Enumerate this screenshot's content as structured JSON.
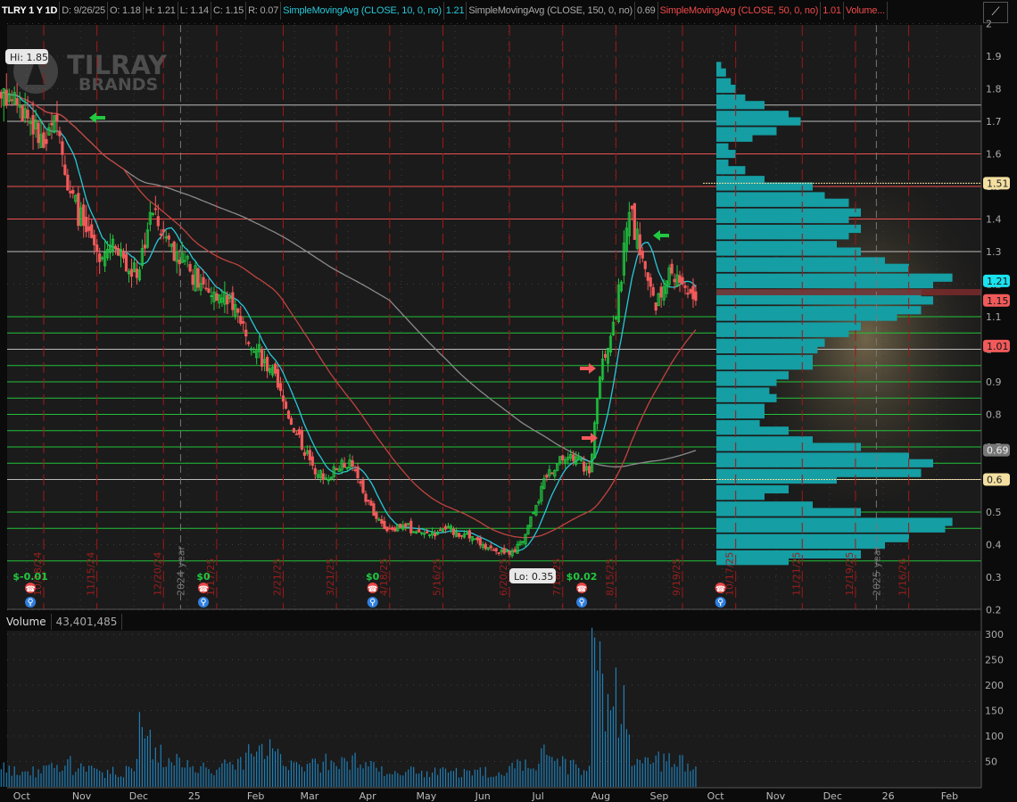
{
  "header": {
    "symbol": "TLRY 1 Y 1D",
    "date": "D: 9/26/25",
    "open": "O: 1.18",
    "high": "H: 1.21",
    "low": "L: 1.14",
    "close": "C: 1.15",
    "range": "R: 0.07",
    "sma10_label": "SimpleMovingAvg (CLOSE, 10, 0, no)",
    "sma10_value": "1.21",
    "sma150_label": "SimpleMovingAvg (CLOSE, 150, 0, no)",
    "sma150_value": "0.69",
    "sma50_label": "SimpleMovingAvg (CLOSE, 50, 0, no)",
    "sma50_value": "1.01",
    "volume_label": "Volume...",
    "studies_icon": "studies-icon"
  },
  "volume_header": {
    "label": "Volume",
    "value": "43,401,485"
  },
  "annotations": {
    "hi": "Hi: 1.85",
    "lo": "Lo: 0.35",
    "logo_line1": "TILRAY",
    "logo_line2": "BRANDS"
  },
  "colors": {
    "up": "#21c840",
    "down": "#f25a5a",
    "sma10": "#27c8d8",
    "sma50": "#c0433f",
    "sma150": "#8a8a8a",
    "profile": "#159ea3",
    "volume": "#1f7fb8"
  },
  "chart_data": {
    "type": "candlestick",
    "title": "TLRY 1 Y 1D",
    "start_date": "2024-09-27",
    "step_days": 7,
    "weekly_close": [
      1.8,
      1.75,
      1.7,
      1.62,
      1.7,
      1.48,
      1.38,
      1.3,
      1.32,
      1.28,
      1.22,
      1.42,
      1.36,
      1.3,
      1.24,
      1.2,
      1.15,
      1.16,
      1.08,
      1.0,
      0.94,
      0.84,
      0.74,
      0.66,
      0.6,
      0.63,
      0.66,
      0.56,
      0.48,
      0.45,
      0.46,
      0.44,
      0.43,
      0.45,
      0.44,
      0.42,
      0.4,
      0.38,
      0.37,
      0.41,
      0.52,
      0.63,
      0.66,
      0.67,
      0.62,
      0.97,
      1.1,
      1.42,
      1.28,
      1.12,
      1.25,
      1.2,
      1.15
    ],
    "weekly_volume_millions": [
      35,
      30,
      32,
      30,
      60,
      45,
      35,
      30,
      28,
      30,
      40,
      110,
      60,
      50,
      45,
      40,
      35,
      40,
      50,
      60,
      70,
      60,
      45,
      40,
      40,
      55,
      45,
      50,
      40,
      30,
      30,
      30,
      28,
      30,
      28,
      30,
      28,
      30,
      35,
      40,
      50,
      60,
      45,
      40,
      30,
      270,
      180,
      150,
      55,
      50,
      50,
      45,
      45
    ],
    "price_axis": {
      "min": 0.2,
      "max": 2.0,
      "ticks": [
        "2",
        "1.9",
        "1.8",
        "1.7",
        "1.6",
        "1.5",
        "1.4",
        "1.3",
        "1.2",
        "1.1",
        "1",
        "0.9",
        "0.8",
        "0.7",
        "0.6",
        "0.5",
        "0.4",
        "0.3",
        "0.2"
      ]
    },
    "volume_axis": {
      "min": 0,
      "max": 300,
      "ticks": [
        "300",
        "250",
        "200",
        "150",
        "100",
        "50"
      ]
    },
    "x_axis_labels": [
      {
        "label": "Oct",
        "date": "2024-10-01"
      },
      {
        "label": "Nov",
        "date": "2024-11-01"
      },
      {
        "label": "Dec",
        "date": "2024-12-01"
      },
      {
        "label": "25",
        "date": "2025-01-01"
      },
      {
        "label": "Feb",
        "date": "2025-02-01"
      },
      {
        "label": "Mar",
        "date": "2025-03-01"
      },
      {
        "label": "Apr",
        "date": "2025-04-01"
      },
      {
        "label": "May",
        "date": "2025-05-01"
      },
      {
        "label": "Jun",
        "date": "2025-06-01"
      },
      {
        "label": "Jul",
        "date": "2025-07-01"
      },
      {
        "label": "Aug",
        "date": "2025-08-01"
      },
      {
        "label": "Sep",
        "date": "2025-09-01"
      },
      {
        "label": "Oct",
        "date": "2025-10-01"
      },
      {
        "label": "Nov",
        "date": "2025-11-01"
      },
      {
        "label": "Dec",
        "date": "2025-12-01"
      },
      {
        "label": "26",
        "date": "2026-01-01"
      },
      {
        "label": "Feb",
        "date": "2026-02-01"
      }
    ],
    "expiration_lines": [
      {
        "label": "10/18/24",
        "date": "2024-10-18"
      },
      {
        "label": "11/15/24",
        "date": "2024-11-15"
      },
      {
        "label": "12/20/24",
        "date": "2024-12-20"
      },
      {
        "label": "1/17/25",
        "date": "2025-01-17"
      },
      {
        "label": "2/21/25",
        "date": "2025-02-21"
      },
      {
        "label": "3/21/25",
        "date": "2025-03-21"
      },
      {
        "label": "4/18/25",
        "date": "2025-04-18"
      },
      {
        "label": "5/16/25",
        "date": "2025-05-16"
      },
      {
        "label": "6/20/25",
        "date": "2025-06-20"
      },
      {
        "label": "7/18/25",
        "date": "2025-07-18"
      },
      {
        "label": "8/15/25",
        "date": "2025-08-15"
      },
      {
        "label": "9/19/25",
        "date": "2025-09-19"
      },
      {
        "label": "10/17/25",
        "date": "2025-10-17"
      },
      {
        "label": "11/21/25",
        "date": "2025-11-21"
      },
      {
        "label": "12/19/25",
        "date": "2025-12-19"
      },
      {
        "label": "1/16/26",
        "date": "2026-01-16"
      }
    ],
    "year_lines": [
      {
        "label": "2024 year",
        "date": "2024-12-29"
      },
      {
        "label": "2025 year",
        "date": "2025-12-30"
      }
    ],
    "earnings": [
      {
        "label": "$-0.01",
        "date": "2024-10-11"
      },
      {
        "label": "$0",
        "date": "2025-01-10"
      },
      {
        "label": "$0",
        "date": "2025-04-09"
      },
      {
        "label": "$0.02",
        "date": "2025-07-28"
      },
      {
        "label": "",
        "date": "2025-10-09"
      }
    ],
    "levels": [
      {
        "price": 1.75,
        "color": "#bbbbbb"
      },
      {
        "price": 1.7,
        "color": "#bbbbbb"
      },
      {
        "price": 1.6,
        "color": "#f05050"
      },
      {
        "price": 1.5,
        "color": "#f05050"
      },
      {
        "price": 1.4,
        "color": "#f05050"
      },
      {
        "price": 1.3,
        "color": "#bbbbbb"
      },
      {
        "price": 1.1,
        "color": "#22c23a"
      },
      {
        "price": 1.05,
        "color": "#22c23a"
      },
      {
        "price": 0.95,
        "color": "#22c23a"
      },
      {
        "price": 0.9,
        "color": "#22c23a"
      },
      {
        "price": 0.85,
        "color": "#22c23a"
      },
      {
        "price": 0.8,
        "color": "#22c23a"
      },
      {
        "price": 0.75,
        "color": "#22c23a"
      },
      {
        "price": 0.7,
        "color": "#22c23a"
      },
      {
        "price": 0.65,
        "color": "#22c23a"
      },
      {
        "price": 0.6,
        "color": "#bbbbbb"
      },
      {
        "price": 0.5,
        "color": "#22c23a"
      },
      {
        "price": 0.45,
        "color": "#22c23a"
      },
      {
        "price": 0.35,
        "color": "#22c23a"
      },
      {
        "price": 1.0,
        "color": "#bbbbbb"
      }
    ],
    "price_badges": [
      {
        "label": "1.51",
        "price": 1.51,
        "bg": "#f3dfa0",
        "fg": "#222"
      },
      {
        "label": "1.21",
        "price": 1.21,
        "bg": "#19e3f0",
        "fg": "#111"
      },
      {
        "label": "1.15",
        "price": 1.15,
        "bg": "#f05a5a",
        "fg": "#111"
      },
      {
        "label": "1.01",
        "price": 1.01,
        "bg": "#f05a5a",
        "fg": "#111"
      },
      {
        "label": "0.69",
        "price": 0.69,
        "bg": "#777777",
        "fg": "#eee"
      },
      {
        "label": "0.6",
        "price": 0.6,
        "bg": "#f3dfa0",
        "fg": "#222"
      }
    ],
    "volume_profile": {
      "step": 0.025,
      "rows": [
        [
          1.87,
          0.02
        ],
        [
          1.85,
          0.04
        ],
        [
          1.82,
          0.06
        ],
        [
          1.8,
          0.08
        ],
        [
          1.77,
          0.12
        ],
        [
          1.75,
          0.2
        ],
        [
          1.72,
          0.3
        ],
        [
          1.7,
          0.35
        ],
        [
          1.67,
          0.25
        ],
        [
          1.65,
          0.15
        ],
        [
          1.62,
          0.05
        ],
        [
          1.6,
          0.08
        ],
        [
          1.57,
          0.05
        ],
        [
          1.55,
          0.12
        ],
        [
          1.52,
          0.2
        ],
        [
          1.5,
          0.4
        ],
        [
          1.47,
          0.45
        ],
        [
          1.45,
          0.55
        ],
        [
          1.42,
          0.6
        ],
        [
          1.4,
          0.55
        ],
        [
          1.37,
          0.6
        ],
        [
          1.35,
          0.55
        ],
        [
          1.32,
          0.5
        ],
        [
          1.3,
          0.6
        ],
        [
          1.27,
          0.7
        ],
        [
          1.25,
          0.8
        ],
        [
          1.22,
          0.98
        ],
        [
          1.2,
          0.9
        ],
        [
          1.17,
          0.85
        ],
        [
          1.15,
          0.9
        ],
        [
          1.12,
          0.85
        ],
        [
          1.1,
          0.75
        ],
        [
          1.07,
          0.6
        ],
        [
          1.05,
          0.55
        ],
        [
          1.02,
          0.45
        ],
        [
          1.0,
          0.42
        ],
        [
          0.97,
          0.4
        ],
        [
          0.95,
          0.4
        ],
        [
          0.92,
          0.3
        ],
        [
          0.9,
          0.25
        ],
        [
          0.87,
          0.22
        ],
        [
          0.85,
          0.25
        ],
        [
          0.82,
          0.2
        ],
        [
          0.8,
          0.2
        ],
        [
          0.77,
          0.18
        ],
        [
          0.75,
          0.3
        ],
        [
          0.72,
          0.4
        ],
        [
          0.7,
          0.6
        ],
        [
          0.67,
          0.8
        ],
        [
          0.65,
          0.9
        ],
        [
          0.62,
          0.85
        ],
        [
          0.6,
          0.5
        ],
        [
          0.57,
          0.3
        ],
        [
          0.55,
          0.2
        ],
        [
          0.52,
          0.4
        ],
        [
          0.5,
          0.6
        ],
        [
          0.47,
          0.98
        ],
        [
          0.45,
          0.95
        ],
        [
          0.42,
          0.8
        ],
        [
          0.4,
          0.7
        ],
        [
          0.37,
          0.6
        ],
        [
          0.35,
          0.3
        ]
      ]
    }
  }
}
